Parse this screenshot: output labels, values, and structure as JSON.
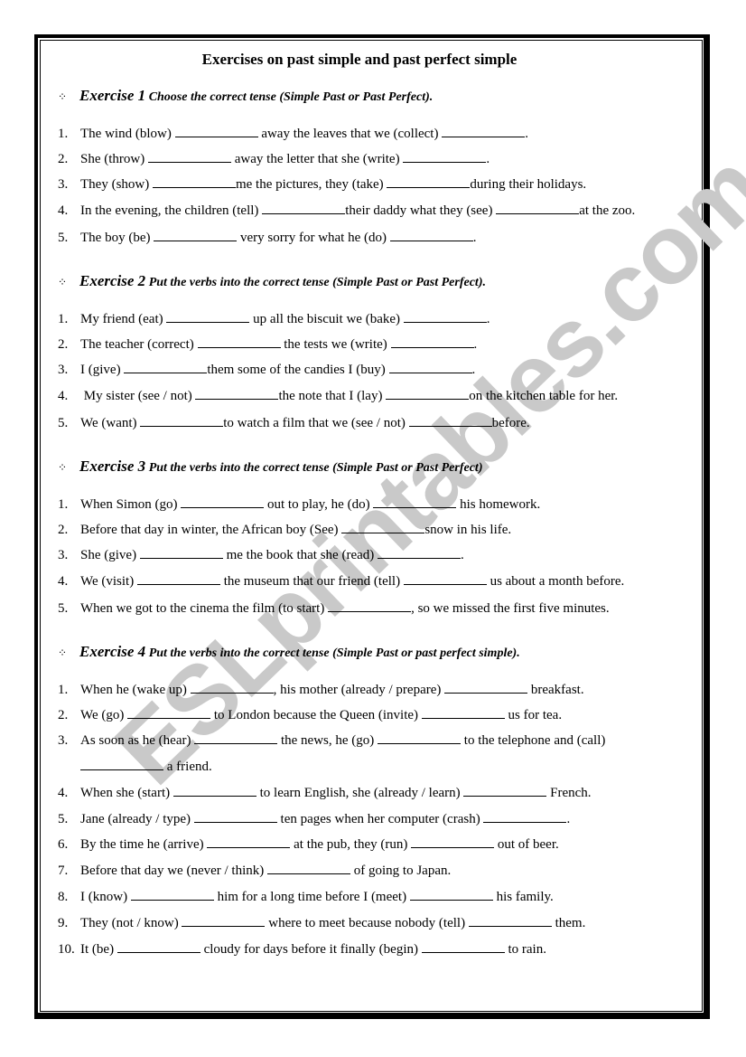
{
  "title": "Exercises on past simple and past perfect simple",
  "watermark": "ESLprintables.com",
  "bullet_icon": "diamond-dots-bullet",
  "exercises": [
    {
      "label": "Exercise 1",
      "instruction": "Choose the correct tense (Simple Past or Past Perfect).",
      "items": [
        {
          "num": "1.",
          "parts": [
            "The wind (blow) ",
            " away the leaves that we (collect) ",
            "."
          ]
        },
        {
          "num": "2.",
          "parts": [
            "She (throw) ",
            " away the letter that she (write) ",
            "."
          ]
        },
        {
          "num": "3.",
          "parts": [
            "They (show) ",
            "me the pictures, they (take) ",
            "during their holidays."
          ]
        },
        {
          "num": "4.",
          "parts": [
            "In the evening, the children (tell) ",
            "their daddy what they (see) ",
            "at the zoo."
          ]
        },
        {
          "num": "5.",
          "parts": [
            "The boy (be) ",
            " very sorry for what he (do) ",
            "."
          ]
        }
      ]
    },
    {
      "label": "Exercise 2",
      "instruction": "Put the verbs into the correct tense (Simple Past or Past Perfect).",
      "items": [
        {
          "num": "1.",
          "parts": [
            "My friend (eat) ",
            " up all the biscuit we (bake) ",
            "."
          ]
        },
        {
          "num": "2.",
          "parts": [
            "The teacher (correct) ",
            " the tests we (write) ",
            "."
          ]
        },
        {
          "num": "3.",
          "parts": [
            "I (give) ",
            "them some of the candies I (buy) ",
            "."
          ]
        },
        {
          "num": "4.",
          "parts": [
            " My sister (see / not) ",
            "the note that I (lay) ",
            "on the kitchen table for her."
          ]
        },
        {
          "num": "5.",
          "parts": [
            "We (want) ",
            "to watch a film that we (see / not) ",
            "before."
          ]
        }
      ]
    },
    {
      "label": "Exercise 3",
      "instruction": "Put the verbs into the correct tense (Simple Past or Past Perfect)",
      "items": [
        {
          "num": "1.",
          "parts": [
            "When Simon (go) ",
            " out to play, he (do) ",
            " his homework."
          ]
        },
        {
          "num": "2.",
          "parts": [
            "Before that day in winter, the African boy (See) ",
            "snow in his life."
          ]
        },
        {
          "num": "3.",
          "parts": [
            "She (give) ",
            " me the book that she (read) ",
            "."
          ]
        },
        {
          "num": "4.",
          "parts": [
            "We (visit) ",
            " the museum that our friend (tell) ",
            " us about a month before."
          ]
        },
        {
          "num": "5.",
          "parts": [
            "When we got to the cinema the film (to start) ",
            ", so we missed the first five minutes."
          ]
        }
      ]
    },
    {
      "label": "Exercise 4",
      "instruction": "Put the verbs into the correct tense (Simple Past or past perfect simple).",
      "items": [
        {
          "num": "1.",
          "parts": [
            "When he (wake up) ",
            ", his mother (already / prepare) ",
            " breakfast."
          ]
        },
        {
          "num": "2.",
          "parts": [
            "We (go) ",
            " to London because the Queen (invite) ",
            " us for tea."
          ]
        },
        {
          "num": "3.",
          "parts": [
            "As soon as he (hear) ",
            " the news, he (go) ",
            " to the telephone and (call)"
          ],
          "continuation": [
            " a friend."
          ]
        },
        {
          "num": "4.",
          "parts": [
            "When she (start) ",
            " to learn English, she (already / learn) ",
            " French."
          ]
        },
        {
          "num": "5.",
          "parts": [
            "Jane (already / type) ",
            " ten pages when her computer (crash) ",
            "."
          ]
        },
        {
          "num": "6.",
          "parts": [
            "By the time he (arrive) ",
            " at the pub, they (run) ",
            " out of beer."
          ]
        },
        {
          "num": "7.",
          "parts": [
            "Before that day we (never / think) ",
            " of going to Japan."
          ]
        },
        {
          "num": "8.",
          "parts": [
            "I (know) ",
            " him for a long time before I (meet) ",
            " his family."
          ]
        },
        {
          "num": "9.",
          "parts": [
            "They (not / know) ",
            " where to meet because nobody (tell) ",
            " them."
          ]
        },
        {
          "num": "10.",
          "parts": [
            "It (be) ",
            " cloudy for days before it finally (begin) ",
            " to rain."
          ]
        }
      ]
    }
  ]
}
